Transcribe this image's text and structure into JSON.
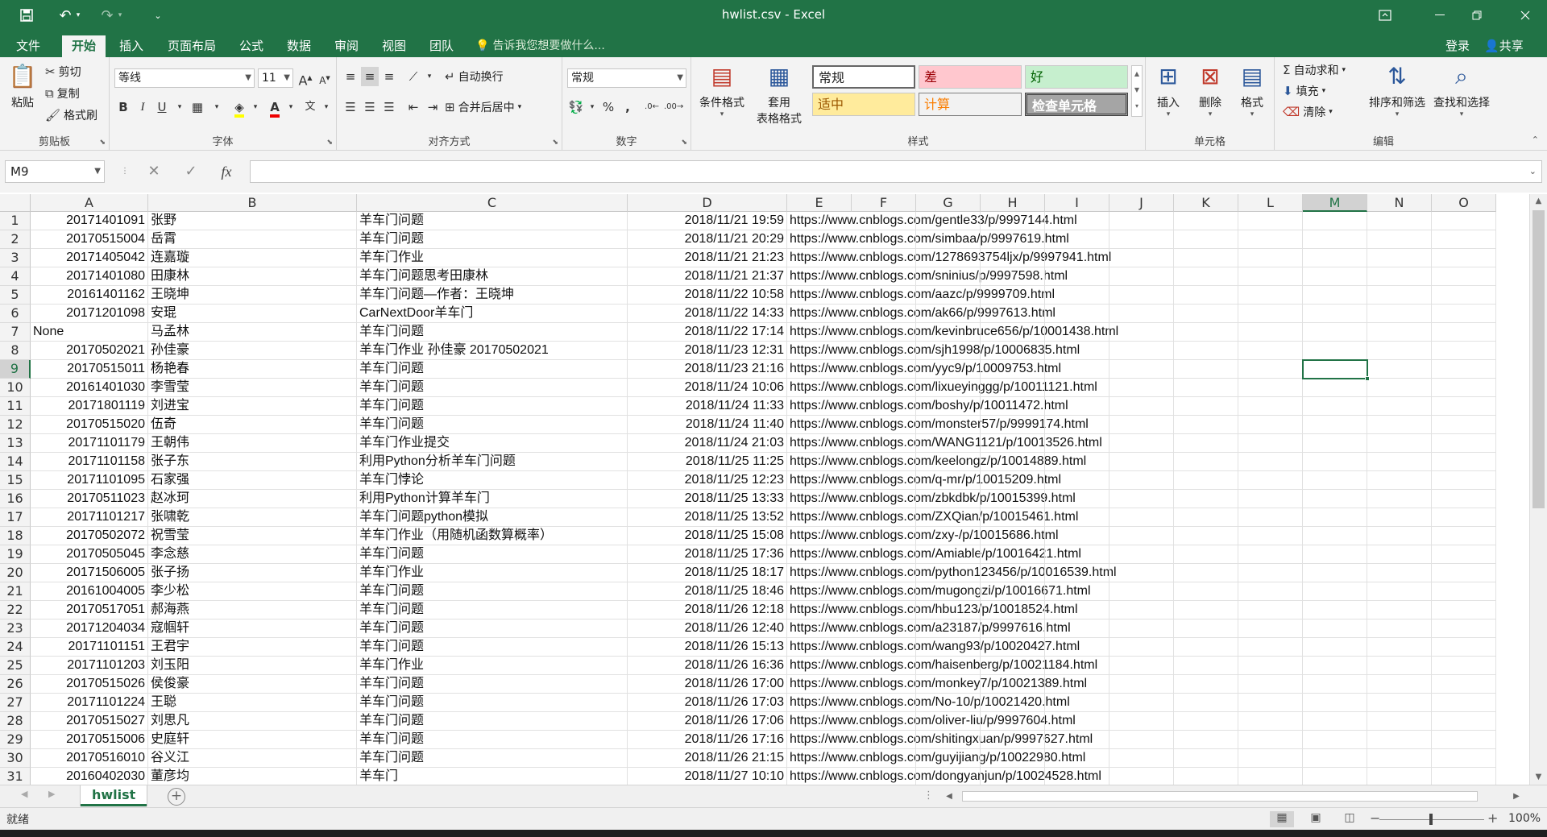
{
  "titlebar": {
    "title": "hwlist.csv - Excel",
    "save_icon": "save-icon",
    "undo_icon": "undo-icon",
    "redo_icon": "redo-icon",
    "ribbon_display_icon": "ribbon-display-icon",
    "minimize": "minimize-icon",
    "restore": "restore-icon",
    "close": "close-icon"
  },
  "tabs": {
    "items": [
      "文件",
      "开始",
      "插入",
      "页面布局",
      "公式",
      "数据",
      "审阅",
      "视图",
      "团队"
    ],
    "active": "开始",
    "tell_me": "告诉我您想要做什么...",
    "signin": "登录",
    "share": "共享"
  },
  "ribbon": {
    "clipboard": {
      "label": "剪贴板",
      "paste": "粘贴",
      "cut": "剪切",
      "copy": "复制",
      "format_painter": "格式刷"
    },
    "font": {
      "label": "字体",
      "font_name": "等线",
      "font_size": "11",
      "bold": "B",
      "italic": "I",
      "underline": "U",
      "grow": "A",
      "shrink": "A"
    },
    "alignment": {
      "label": "对齐方式",
      "wrap_text": "自动换行",
      "merge_center": "合并后居中"
    },
    "number": {
      "label": "数字",
      "format": "常规",
      "percent": "%",
      "comma": ","
    },
    "styles": {
      "label": "样式",
      "conditional_formatting": "条件格式",
      "format_as_table_1": "套用",
      "format_as_table_2": "表格格式",
      "normal": "常规",
      "bad": "差",
      "good": "好",
      "neutral": "适中",
      "calculation": "计算",
      "check_cell": "检查单元格"
    },
    "cells": {
      "label": "单元格",
      "insert": "插入",
      "delete": "删除",
      "format": "格式"
    },
    "editing": {
      "label": "编辑",
      "autosum": "自动求和",
      "fill": "填充",
      "clear": "清除",
      "sort_filter": "排序和筛选",
      "find_select": "查找和选择"
    }
  },
  "formula_bar": {
    "name_box": "M9",
    "fx": "fx",
    "formula": ""
  },
  "columns": [
    "A",
    "B",
    "C",
    "D",
    "E",
    "F",
    "G",
    "H",
    "I",
    "J",
    "K",
    "L",
    "M",
    "N",
    "O"
  ],
  "selected_column": "M",
  "selected_row": 9,
  "rows": [
    {
      "n": "1",
      "a": "20171401091",
      "b": "张野",
      "c": "羊车门问题",
      "d": "2018/11/21 19:59",
      "e": "https://www.cnblogs.com/gentle33/p/9997144.html"
    },
    {
      "n": "2",
      "a": "20170515004",
      "b": "岳霄",
      "c": "羊车门问题",
      "d": "2018/11/21 20:29",
      "e": "https://www.cnblogs.com/simbaa/p/9997619.html"
    },
    {
      "n": "3",
      "a": "20171405042",
      "b": "连嘉璇",
      "c": "羊车门作业",
      "d": "2018/11/21 21:23",
      "e": "https://www.cnblogs.com/1278693754ljx/p/9997941.html"
    },
    {
      "n": "4",
      "a": "20171401080",
      "b": "田康林",
      "c": "羊车门问题思考田康林",
      "d": "2018/11/21 21:37",
      "e": "https://www.cnblogs.com/sninius/p/9997598.html"
    },
    {
      "n": "5",
      "a": "20161401162",
      "b": "王晓坤",
      "c": "羊车门问题—作者：王晓坤",
      "d": "2018/11/22 10:58",
      "e": "https://www.cnblogs.com/aazc/p/9999709.html"
    },
    {
      "n": "6",
      "a": "20171201098",
      "b": "安琨",
      "c": "CarNextDoor羊车门",
      "d": "2018/11/22 14:33",
      "e": "https://www.cnblogs.com/ak66/p/9997613.html"
    },
    {
      "n": "7",
      "a": "None",
      "a_left": true,
      "b": "马孟林",
      "c": "羊车门问题",
      "d": "2018/11/22 17:14",
      "e": "https://www.cnblogs.com/kevinbruce656/p/10001438.html"
    },
    {
      "n": "8",
      "a": "20170502021",
      "b": "孙佳豪",
      "c": "羊车门作业 孙佳豪 20170502021",
      "d": "2018/11/23 12:31",
      "e": "https://www.cnblogs.com/sjh1998/p/10006835.html"
    },
    {
      "n": "9",
      "a": "20170515011",
      "b": "杨艳春",
      "c": "羊车门问题",
      "d": "2018/11/23 21:16",
      "e": "https://www.cnblogs.com/yyc9/p/10009753.html"
    },
    {
      "n": "10",
      "a": "20161401030",
      "b": "李雪莹",
      "c": "羊车门问题",
      "d": "2018/11/24 10:06",
      "e": "https://www.cnblogs.com/lixueyinggg/p/10011121.html"
    },
    {
      "n": "11",
      "a": "20171801119",
      "b": "刘进宝",
      "c": "羊车门问题",
      "d": "2018/11/24 11:33",
      "e": "https://www.cnblogs.com/boshy/p/10011472.html"
    },
    {
      "n": "12",
      "a": "20170515020",
      "b": "伍奇",
      "c": "羊车门问题",
      "d": "2018/11/24 11:40",
      "e": "https://www.cnblogs.com/monster57/p/9999174.html"
    },
    {
      "n": "13",
      "a": "20171101179",
      "b": "王朝伟",
      "c": "羊车门作业提交",
      "d": "2018/11/24 21:03",
      "e": "https://www.cnblogs.com/WANG1121/p/10013526.html"
    },
    {
      "n": "14",
      "a": "20171101158",
      "b": "张子东",
      "c": "利用Python分析羊车门问题",
      "d": "2018/11/25 11:25",
      "e": "https://www.cnblogs.com/keelongz/p/10014889.html"
    },
    {
      "n": "15",
      "a": "20171101095",
      "b": "石家强",
      "c": "羊车门悖论",
      "d": "2018/11/25 12:23",
      "e": "https://www.cnblogs.com/q-mr/p/10015209.html"
    },
    {
      "n": "16",
      "a": "20170511023",
      "b": "赵冰珂",
      "c": "利用Python计算羊车门",
      "d": "2018/11/25 13:33",
      "e": "https://www.cnblogs.com/zbkdbk/p/10015399.html"
    },
    {
      "n": "17",
      "a": "20171101217",
      "b": "张啸乾",
      "c": "羊车门问题python模拟",
      "d": "2018/11/25 13:52",
      "e": "https://www.cnblogs.com/ZXQian/p/10015461.html"
    },
    {
      "n": "18",
      "a": "20170502072",
      "b": "祝雪莹",
      "c": "羊车门作业（用随机函数算概率）",
      "d": "2018/11/25 15:08",
      "e": "https://www.cnblogs.com/zxy-/p/10015686.html"
    },
    {
      "n": "19",
      "a": "20170505045",
      "b": "李念慈",
      "c": "羊车门问题",
      "d": "2018/11/25 17:36",
      "e": "https://www.cnblogs.com/Amiable/p/10016421.html"
    },
    {
      "n": "20",
      "a": "20171506005",
      "b": "张子扬",
      "c": "羊车门作业",
      "d": "2018/11/25 18:17",
      "e": "https://www.cnblogs.com/python123456/p/10016539.html"
    },
    {
      "n": "21",
      "a": "20161004005",
      "b": "李少松",
      "c": "羊车门问题",
      "d": "2018/11/25 18:46",
      "e": "https://www.cnblogs.com/mugongzi/p/10016671.html"
    },
    {
      "n": "22",
      "a": "20170517051",
      "b": "郝海燕",
      "c": "羊车门问题",
      "d": "2018/11/26 12:18",
      "e": "https://www.cnblogs.com/hbu123/p/10018524.html"
    },
    {
      "n": "23",
      "a": "20171204034",
      "b": "寇帼轩",
      "c": "羊车门问题",
      "d": "2018/11/26 12:40",
      "e": "https://www.cnblogs.com/a23187/p/9997616.html"
    },
    {
      "n": "24",
      "a": "20171101151",
      "b": "王君宇",
      "c": "羊车门问题",
      "d": "2018/11/26 15:13",
      "e": "https://www.cnblogs.com/wang93/p/10020427.html"
    },
    {
      "n": "25",
      "a": "20171101203",
      "b": "刘玉阳",
      "c": "羊车门作业",
      "d": "2018/11/26 16:36",
      "e": "https://www.cnblogs.com/haisenberg/p/10021184.html"
    },
    {
      "n": "26",
      "a": "20170515026",
      "b": "侯俊豪",
      "c": "羊车门问题",
      "d": "2018/11/26 17:00",
      "e": "https://www.cnblogs.com/monkey7/p/10021389.html"
    },
    {
      "n": "27",
      "a": "20171101224",
      "b": "王聪",
      "c": "羊车门问题",
      "d": "2018/11/26 17:03",
      "e": "https://www.cnblogs.com/No-10/p/10021420.html"
    },
    {
      "n": "28",
      "a": "20170515027",
      "b": "刘思凡",
      "c": "羊车门问题",
      "d": "2018/11/26 17:06",
      "e": "https://www.cnblogs.com/oliver-liu/p/9997604.html"
    },
    {
      "n": "29",
      "a": "20170515006",
      "b": "史庭轩",
      "c": "羊车门问题",
      "d": "2018/11/26 17:16",
      "e": "https://www.cnblogs.com/shitingxuan/p/9997627.html"
    },
    {
      "n": "30",
      "a": "20170516010",
      "b": "谷义江",
      "c": "羊车门问题",
      "d": "2018/11/26 21:15",
      "e": "https://www.cnblogs.com/guyijiang/p/10022980.html"
    },
    {
      "n": "31",
      "a": "20160402030",
      "b": "董彦均",
      "c": "羊车门",
      "d": "2018/11/27 10:10",
      "e": "https://www.cnblogs.com/dongyanjun/p/10024528.html"
    }
  ],
  "sheet": {
    "tab": "hwlist",
    "add_icon": "add-sheet-icon"
  },
  "status": {
    "ready": "就绪",
    "zoom": "100%",
    "zoom_minus": "−",
    "zoom_plus": "+"
  }
}
